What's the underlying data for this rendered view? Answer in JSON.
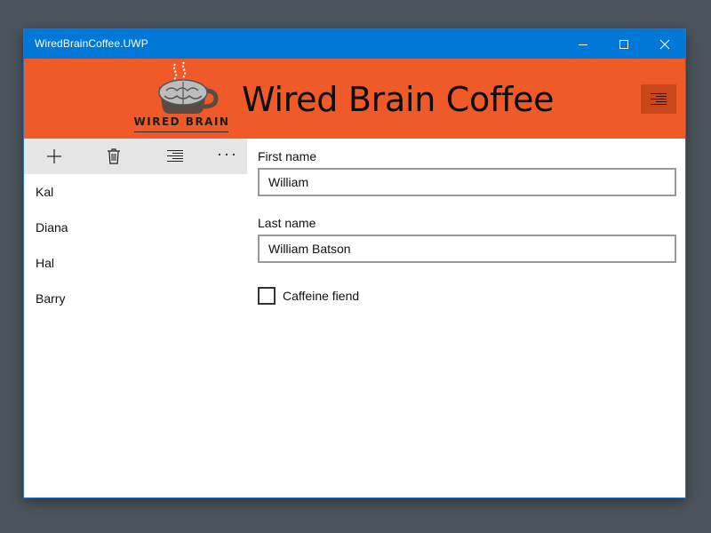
{
  "window": {
    "title": "WiredBrainCoffee.UWP",
    "caption_buttons": [
      "minimize-icon",
      "maximize-icon",
      "close-icon"
    ]
  },
  "header": {
    "logo_text": "WIRED BRAIN",
    "app_title": "Wired Brain Coffee",
    "menu_icon": "align-right-icon"
  },
  "toolbar": {
    "icons": [
      "add-icon",
      "delete-icon",
      "align-right-icon",
      "more-icon"
    ],
    "more_label": "···"
  },
  "customers": [
    "Kal",
    "Diana",
    "Hal",
    "Barry"
  ],
  "form": {
    "first_name_label": "First name",
    "first_name_value": "William",
    "last_name_label": "Last name",
    "last_name_value": "William Batson",
    "caffeine_label": "Caffeine fiend",
    "caffeine_checked": false
  },
  "colors": {
    "titlebar": "#0078d7",
    "header": "#f05a28",
    "header_button": "#c9461b",
    "toolbar": "#e6e6e6",
    "desktop": "#4b545c"
  }
}
